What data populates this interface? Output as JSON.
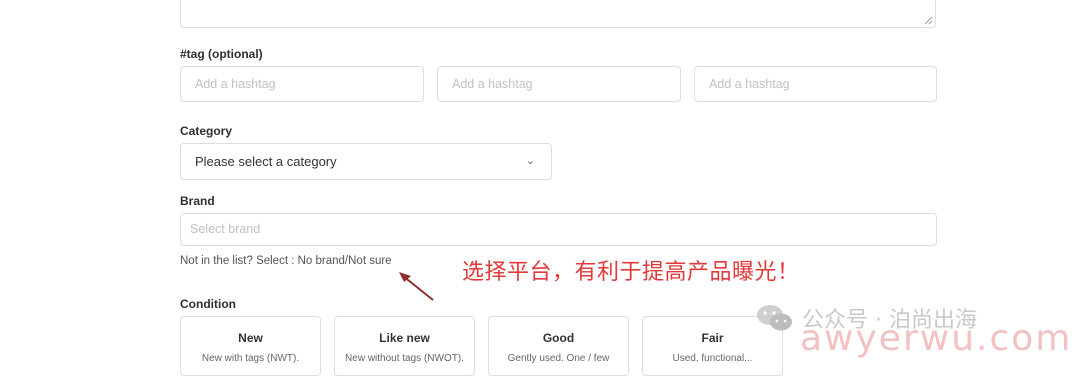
{
  "form": {
    "tag_label": "#tag (optional)",
    "tag_placeholders": [
      "Add a hashtag",
      "Add a hashtag",
      "Add a hashtag"
    ],
    "category_label": "Category",
    "category_value": "Please select a category",
    "brand_label": "Brand",
    "brand_placeholder": "Select brand",
    "brand_hint": "Not in the list? Select : No brand/Not sure",
    "condition_label": "Condition",
    "conditions": [
      {
        "title": "New",
        "desc": "New with tags (NWT)."
      },
      {
        "title": "Like new",
        "desc": "New without tags (NWOT)."
      },
      {
        "title": "Good",
        "desc": "Gently used. One / few"
      },
      {
        "title": "Fair",
        "desc": "Used, functional..."
      }
    ]
  },
  "annotation": {
    "text": "选择平台，有利于提高产品曝光！",
    "color": "#e23a3a"
  },
  "watermark": {
    "text": "公众号 · 泊尚出海",
    "overlay": "awyerwu.com"
  },
  "icons": {
    "dropdown": "chevron-down-icon",
    "resize": "resize-handle-icon",
    "wechat": "wechat-icon",
    "arrow": "annotation-arrow-icon"
  }
}
